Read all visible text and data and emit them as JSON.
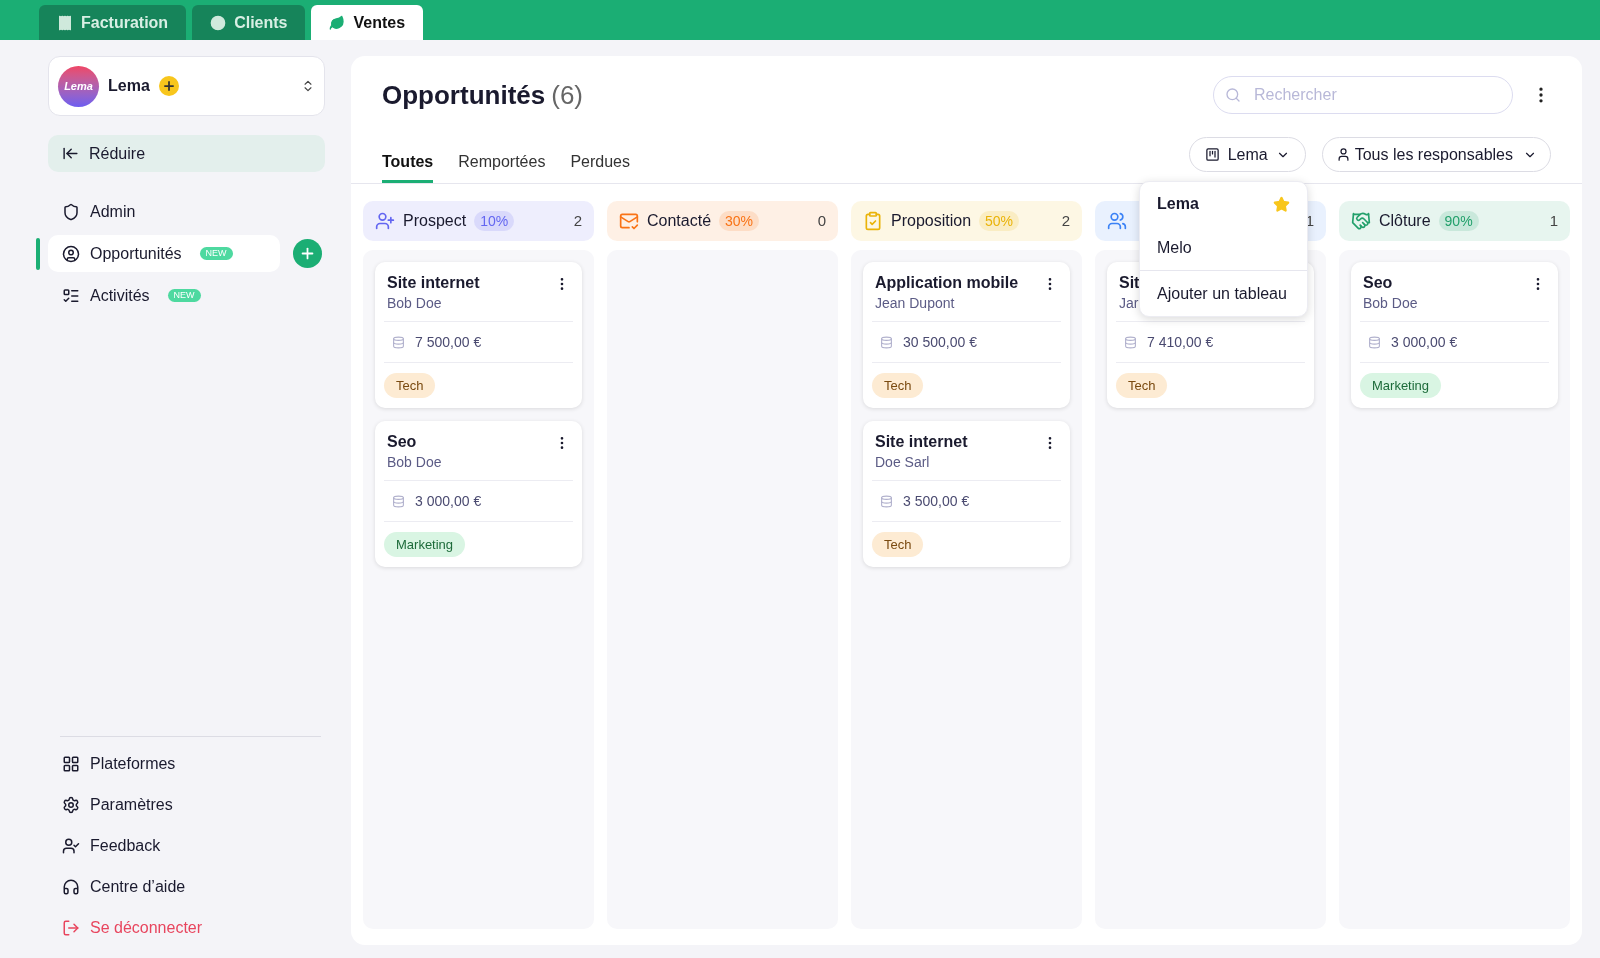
{
  "app_tabs": [
    {
      "label": "Facturation",
      "selected": false
    },
    {
      "label": "Clients",
      "selected": false
    },
    {
      "label": "Ventes",
      "selected": true
    }
  ],
  "workspace": {
    "avatar": "Lema",
    "name": "Lema"
  },
  "collapse": "Réduire",
  "nav": [
    {
      "label": "Admin",
      "selected": false
    },
    {
      "label": "Opportunités",
      "badge": "NEW",
      "selected": true
    },
    {
      "label": "Activités",
      "badge": "NEW",
      "selected": false
    }
  ],
  "nav_bottom": [
    {
      "label": "Plateformes",
      "kind": "normal"
    },
    {
      "label": "Paramètres",
      "kind": "normal"
    },
    {
      "label": "Feedback",
      "kind": "normal"
    },
    {
      "label": "Centre d’aide",
      "kind": "normal"
    },
    {
      "label": "Se déconnecter",
      "kind": "danger"
    }
  ],
  "page": {
    "title": "Opportunités",
    "count": "(6)",
    "search": {
      "placeholder": "Rechercher"
    },
    "board_filter": "Lema",
    "owner_filter": "Tous les responsables"
  },
  "tabs": [
    {
      "label": "Toutes",
      "selected": true
    },
    {
      "label": "Remportées",
      "selected": false
    },
    {
      "label": "Perdues",
      "selected": false
    }
  ],
  "board_menu": {
    "items": [
      {
        "label": "Lema",
        "selected": true,
        "favorite": true
      },
      {
        "label": "Melo",
        "selected": false,
        "favorite": false
      }
    ],
    "action": "Ajouter un tableau"
  },
  "columns": [
    {
      "title": "Prospect",
      "percent": "10%",
      "count": "2",
      "color": "#6366f1",
      "cards": [
        {
          "title": "Site internet",
          "client": "Bob Doe",
          "amount": "7 500,00 €",
          "tag": {
            "label": "Tech",
            "kind": "tech"
          }
        },
        {
          "title": "Seo",
          "client": "Bob Doe",
          "amount": "3 000,00 €",
          "tag": {
            "label": "Marketing",
            "kind": "marketing"
          }
        }
      ]
    },
    {
      "title": "Contacté",
      "percent": "30%",
      "count": "0",
      "color": "#f97316"
    },
    {
      "title": "Proposition",
      "percent": "50%",
      "count": "2",
      "color": "#eab308",
      "cards": [
        {
          "title": "Application mobile",
          "client": "Jean Dupont",
          "amount": "30 500,00 €",
          "tag": {
            "label": "Tech",
            "kind": "tech"
          }
        },
        {
          "title": "Site internet",
          "client": "Doe Sarl",
          "amount": "3 500,00 €",
          "tag": {
            "label": "Tech",
            "kind": "tech"
          }
        }
      ]
    },
    {
      "count": "1",
      "color": "#3b82f6",
      "cards": [
        {
          "title": "Sit",
          "client": "Jar",
          "amount": "7 410,00 €",
          "tag": {
            "label": "Tech",
            "kind": "tech"
          }
        }
      ]
    },
    {
      "title": "Clôture",
      "percent": "90%",
      "count": "1",
      "color": "#22a06b",
      "cards": [
        {
          "title": "Seo",
          "client": "Bob Doe",
          "amount": "3 000,00 €",
          "tag": {
            "label": "Marketing",
            "kind": "marketing"
          }
        }
      ]
    }
  ]
}
